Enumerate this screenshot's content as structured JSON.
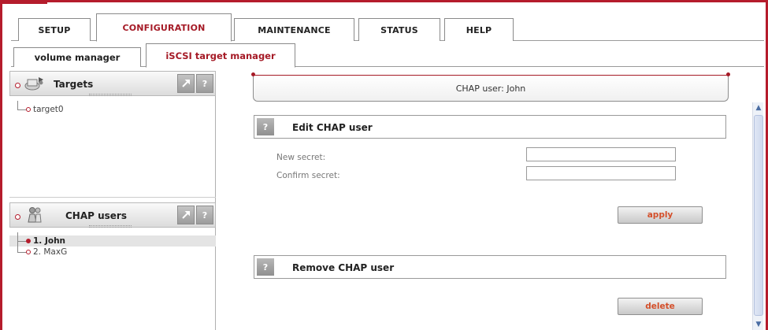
{
  "main_tabs": [
    {
      "label": "SETUP",
      "active": false
    },
    {
      "label": "CONFIGURATION",
      "active": true
    },
    {
      "label": "MAINTENANCE",
      "active": false
    },
    {
      "label": "STATUS",
      "active": false
    },
    {
      "label": "HELP",
      "active": false
    }
  ],
  "sub_tabs": [
    {
      "label": "volume manager",
      "active": false
    },
    {
      "label": "iSCSI target manager",
      "active": true
    }
  ],
  "targets_panel": {
    "title": "Targets",
    "tool_icon": "wrench-icon",
    "help_label": "?",
    "items": [
      "target0"
    ]
  },
  "chap_panel": {
    "title": "CHAP users",
    "tool_icon": "wrench-icon",
    "help_label": "?",
    "items": [
      "1. John",
      "2. MaxG"
    ],
    "selected": "1. John"
  },
  "page_header": "CHAP user: John",
  "edit_section": {
    "help_label": "?",
    "title": "Edit CHAP user",
    "new_secret_label": "New secret:",
    "confirm_secret_label": "Confirm secret:",
    "new_secret_value": "",
    "confirm_secret_value": "",
    "apply_label": "apply"
  },
  "remove_section": {
    "help_label": "?",
    "title": "Remove CHAP user",
    "delete_label": "delete"
  },
  "colors": {
    "accent": "#b51c2c",
    "active_tab_text": "#a51a26",
    "button_text": "#d44f2a"
  }
}
